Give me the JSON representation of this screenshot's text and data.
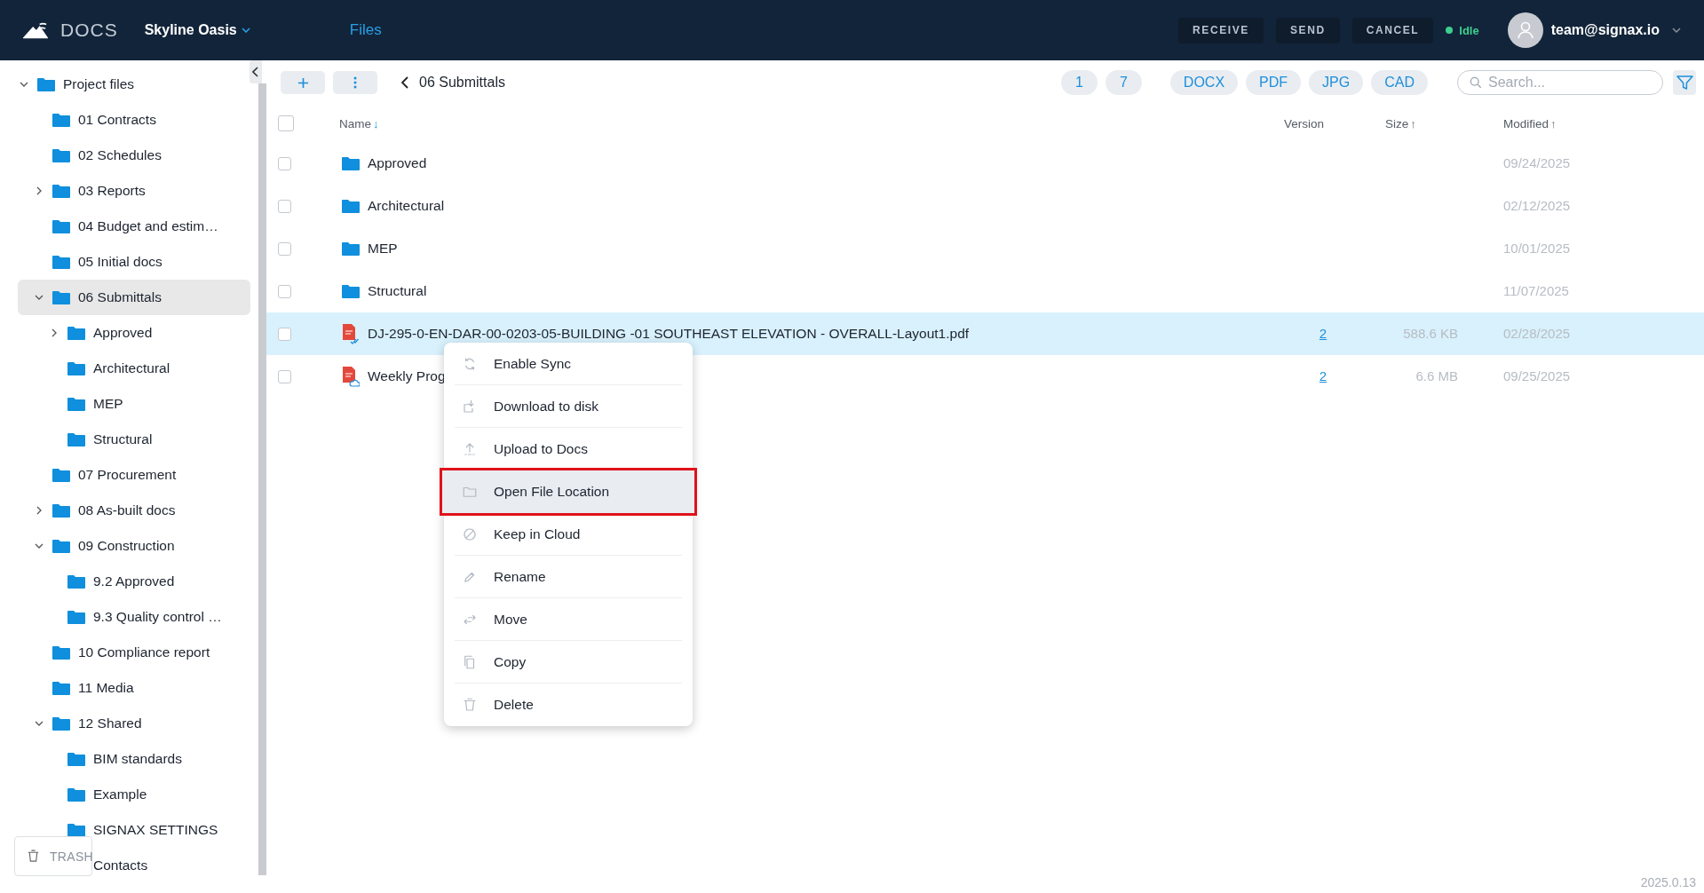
{
  "header": {
    "app": "DOCS",
    "project": "Skyline Oasis",
    "nav": [
      {
        "label": "Files",
        "selected": true
      }
    ],
    "actions": [
      "RECEIVE",
      "SEND",
      "CANCEL"
    ],
    "status": "Idle",
    "user": "team@signax.io"
  },
  "sidebar": {
    "tree": [
      {
        "label": "Project files",
        "expanded": true,
        "selected": false,
        "children": [
          {
            "label": "01 Contracts",
            "selected": false
          },
          {
            "label": "02 Schedules",
            "selected": false
          },
          {
            "label": "03 Reports",
            "expanded": false,
            "selected": false
          },
          {
            "label": "04 Budget and estim…",
            "selected": false
          },
          {
            "label": "05 Initial docs",
            "selected": false
          },
          {
            "label": "06 Submittals",
            "expanded": true,
            "selected": true,
            "children": [
              {
                "label": "Approved",
                "expanded": false,
                "selected": false
              },
              {
                "label": "Architectural",
                "selected": false
              },
              {
                "label": "MEP",
                "selected": false
              },
              {
                "label": "Structural",
                "selected": false
              }
            ]
          },
          {
            "label": "07 Procurement",
            "selected": false
          },
          {
            "label": "08 As-built docs",
            "expanded": false,
            "selected": false
          },
          {
            "label": "09 Construction",
            "expanded": true,
            "selected": false,
            "children": [
              {
                "label": "9.2 Approved",
                "selected": false
              },
              {
                "label": "9.3 Quality control …",
                "selected": false
              }
            ]
          },
          {
            "label": "10 Compliance report",
            "selected": false
          },
          {
            "label": "11 Media",
            "selected": false
          },
          {
            "label": "12 Shared",
            "expanded": true,
            "selected": false,
            "children": [
              {
                "label": "BIM standards",
                "selected": false
              },
              {
                "label": "Example",
                "selected": false
              },
              {
                "label": "SIGNAX SETTINGS",
                "selected": false
              },
              {
                "label": "Contacts",
                "selected": false
              }
            ]
          }
        ]
      }
    ],
    "trash": "TRASH"
  },
  "toolbar": {
    "breadcrumb": "06 Submittals",
    "counts": [
      "1",
      "7"
    ],
    "filters": [
      "DOCX",
      "PDF",
      "JPG",
      "CAD"
    ],
    "search": {
      "placeholder": "Search..."
    }
  },
  "table": {
    "select_all": {
      "checked": false
    },
    "columns": [
      {
        "label": "Name",
        "sort_arrow": "↓",
        "active": true
      },
      {
        "label": "Version"
      },
      {
        "label": "Size",
        "sort_arrow": "↑",
        "active": false
      },
      {
        "label": "Modified",
        "sort_arrow": "↑",
        "active": false
      }
    ],
    "rows": [
      {
        "kind": "folder",
        "name": "Approved",
        "modified": "09/24/2025",
        "checked": false,
        "selected": false
      },
      {
        "kind": "folder",
        "name": "Architectural",
        "modified": "02/12/2025",
        "checked": false,
        "selected": false
      },
      {
        "kind": "folder",
        "name": "MEP",
        "modified": "10/01/2025",
        "checked": false,
        "selected": false
      },
      {
        "kind": "folder",
        "name": "Structural",
        "modified": "11/07/2025",
        "checked": false,
        "selected": false
      },
      {
        "kind": "synced-pdf",
        "name": "DJ-295-0-EN-DAR-00-0203-05-BUILDING -01 SOUTHEAST ELEVATION - OVERALL-Layout1.pdf",
        "version": "2",
        "size": "588.6 KB",
        "modified": "02/28/2025",
        "checked": false,
        "selected": true
      },
      {
        "kind": "cloud-pdf",
        "name": "Weekly Prog",
        "version": "2",
        "size": "6.6 MB",
        "modified": "09/25/2025",
        "checked": false,
        "selected": false
      }
    ]
  },
  "context_menu": {
    "items": [
      {
        "kind": "sync",
        "label": "Enable Sync",
        "selected": false
      },
      {
        "kind": "download",
        "label": "Download to disk",
        "selected": false
      },
      {
        "kind": "upload",
        "label": "Upload to Docs",
        "selected": false
      },
      {
        "kind": "folder",
        "label": "Open File Location",
        "selected": true
      },
      {
        "kind": "ban",
        "label": "Keep in Cloud",
        "selected": false
      },
      {
        "kind": "rename",
        "label": "Rename",
        "selected": false
      },
      {
        "kind": "move",
        "label": "Move",
        "selected": false
      },
      {
        "kind": "copy",
        "label": "Copy",
        "selected": false
      },
      {
        "kind": "delete",
        "label": "Delete",
        "selected": false
      }
    ]
  },
  "version": "2025.0.13"
}
